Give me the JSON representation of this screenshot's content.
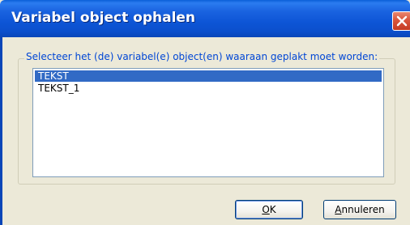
{
  "window": {
    "title": "Variabel object ophalen"
  },
  "group": {
    "label": "Selecteer het (de) variabel(e) object(en) waaraan geplakt moet worden:"
  },
  "list": {
    "items": [
      {
        "label": "TEKST",
        "selected": true
      },
      {
        "label": "TEKST_1",
        "selected": false
      }
    ]
  },
  "buttons": {
    "ok": {
      "mnemonic": "O",
      "rest": "K"
    },
    "cancel": {
      "mnemonic": "A",
      "rest": "nnuleren"
    }
  },
  "colors": {
    "titlebar": "#0b4fcc",
    "selection": "#316ac5",
    "group_label": "#0046d5",
    "close": "#d9553c"
  }
}
